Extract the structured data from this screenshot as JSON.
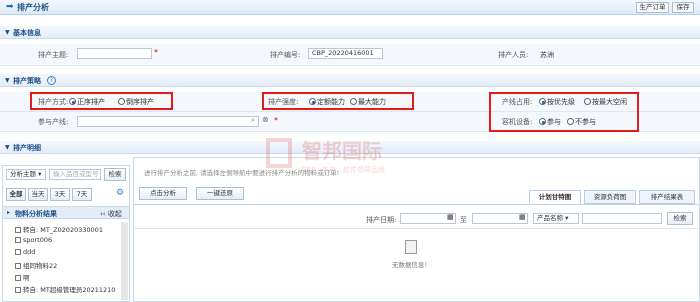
{
  "header": {
    "title": "排产分析",
    "btn_order": "生产订单",
    "btn_save": "保存"
  },
  "basic": {
    "section_title": "基本信息",
    "topic_label": "排产主题:",
    "topic_value": "",
    "code_label": "排产编号:",
    "code_value": "CBP_20220416001",
    "person_label": "排产人员:",
    "person_value": "苏洲"
  },
  "strategy": {
    "section_title": "排产策略",
    "mode_label": "排产方式:",
    "mode_options": [
      "正序排产",
      "倒序排产"
    ],
    "intensity_label": "排产强度:",
    "intensity_options": [
      "定额能力",
      "最大能力"
    ],
    "line_label": "产线占用:",
    "line_options": [
      "按优先级",
      "按最大空闲"
    ],
    "line_param_label": "参与产线:",
    "capacity_label": "容机设备:",
    "capacity_options": [
      "参与",
      "不参与"
    ]
  },
  "detail": {
    "section_title": "排产明细",
    "filter_select": "分析主题",
    "filter_placeholder": "输入品目或型号",
    "search_btn": "检索",
    "tabs_left": [
      "全部",
      "当天",
      "3天",
      "7天"
    ],
    "tree_title": "物料分析结果",
    "collapse": "收起",
    "tree_items": [
      "转自: MT_Z02020330001",
      "sport006",
      "ddd",
      "组同物料22",
      "啊",
      "转自: MT超级管理员20211210"
    ],
    "hint": "进行排产分析之前, 请选择左侧导航中要进行排产分析的物料或订单!",
    "btn_analyze": "点击分析",
    "btn_revert": "一键还原",
    "tabs_right": [
      "计划甘特图",
      "资源负荷图",
      "排产结果表"
    ],
    "date_label": "排产日期:",
    "date_to": "至",
    "product_select": "产品名称",
    "search_btn2": "检索",
    "empty": "无数据信息!"
  },
  "watermark": {
    "brand": "智邦国际",
    "slogan": "ERP · 生产 · 软件领导品牌"
  },
  "colors": {
    "accent": "#1d4f86",
    "highlight": "#e31b1b",
    "watermark": "#d9534f"
  }
}
